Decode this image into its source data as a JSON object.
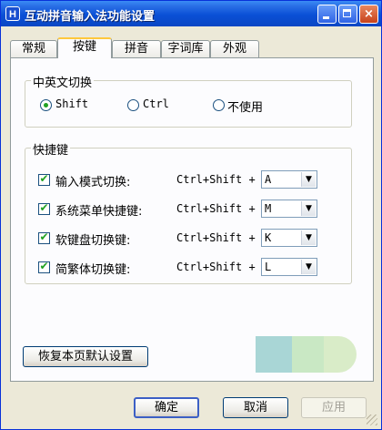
{
  "window": {
    "title": "互动拼音输入法功能设置",
    "icon": "H"
  },
  "titlebar_buttons": {
    "minimize": "minimize-icon",
    "maximize": "maximize-icon",
    "close": "×"
  },
  "tabs": [
    {
      "label": "常规"
    },
    {
      "label": "按键"
    },
    {
      "label": "拼音"
    },
    {
      "label": "字词库"
    },
    {
      "label": "外观"
    }
  ],
  "active_tab": "按键",
  "switch_group": {
    "title": "中英文切换",
    "options": [
      {
        "label": "Shift",
        "selected": true
      },
      {
        "label": "Ctrl",
        "selected": false
      },
      {
        "label": "不使用",
        "selected": false
      }
    ]
  },
  "hotkey_group": {
    "title": "快捷键",
    "rows": [
      {
        "label": "输入模式切换:",
        "checked": true,
        "modifier": "Ctrl+Shift +",
        "key": "A"
      },
      {
        "label": "系统菜单快捷键:",
        "checked": true,
        "modifier": "Ctrl+Shift +",
        "key": "M"
      },
      {
        "label": "软键盘切换键:",
        "checked": true,
        "modifier": "Ctrl+Shift +",
        "key": "K"
      },
      {
        "label": "简繁体切换键:",
        "checked": true,
        "modifier": "Ctrl+Shift +",
        "key": "L"
      }
    ]
  },
  "restore_button": "恢复本页默认设置",
  "footer": {
    "ok": "确定",
    "cancel": "取消",
    "apply": "应用"
  },
  "colors": {
    "titlebar": "#0a50d6",
    "accent": "#21a121",
    "tab_highlight": "#ffc83c"
  }
}
